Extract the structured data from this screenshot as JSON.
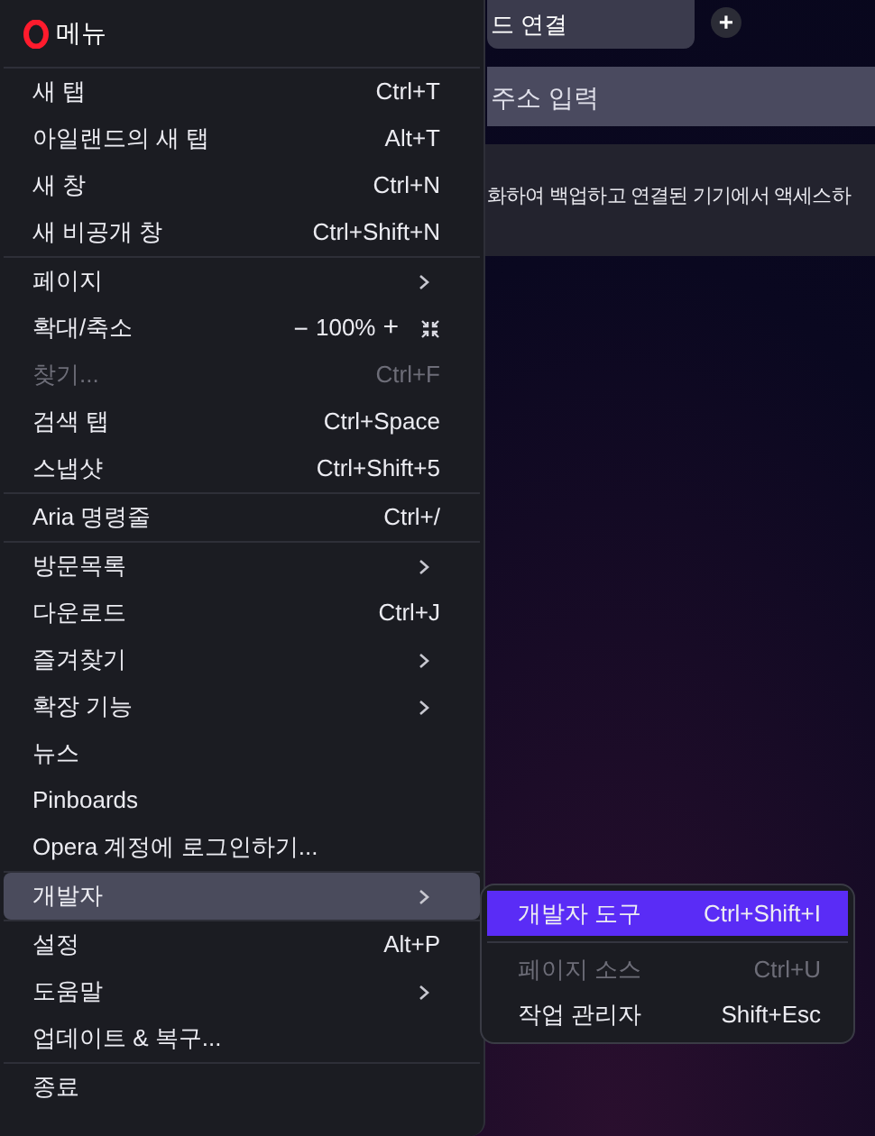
{
  "browser": {
    "tab": {
      "label": "드 연결"
    },
    "new_tab_button": "+",
    "address_bar": {
      "placeholder": "주소 입력"
    },
    "banner": {
      "text": "화하여 백업하고 연결된 기기에서 액세스하"
    }
  },
  "menu": {
    "title": "메뉴",
    "groups": [
      [
        {
          "kind": "item",
          "label": "새 탭",
          "shortcut": "Ctrl+T",
          "submenu": false,
          "disabled": false,
          "selected": false
        },
        {
          "kind": "item",
          "label": "아일랜드의 새 탭",
          "shortcut": "Alt+T",
          "submenu": false,
          "disabled": false,
          "selected": false
        },
        {
          "kind": "item",
          "label": "새 창",
          "shortcut": "Ctrl+N",
          "submenu": false,
          "disabled": false,
          "selected": false
        },
        {
          "kind": "item",
          "label": "새 비공개 창",
          "shortcut": "Ctrl+Shift+N",
          "submenu": false,
          "disabled": false,
          "selected": false
        }
      ],
      [
        {
          "kind": "item",
          "label": "페이지",
          "submenu": true,
          "disabled": false,
          "selected": false
        },
        {
          "kind": "zoom",
          "label": "확대/축소",
          "zoom_out": "−",
          "zoom_value": "100%",
          "zoom_in": "+",
          "disabled": false,
          "selected": false
        },
        {
          "kind": "item",
          "label": "찾기...",
          "shortcut": "Ctrl+F",
          "submenu": false,
          "disabled": true,
          "selected": false
        },
        {
          "kind": "item",
          "label": "검색 탭",
          "shortcut": "Ctrl+Space",
          "submenu": false,
          "disabled": false,
          "selected": false
        },
        {
          "kind": "item",
          "label": "스냅샷",
          "shortcut": "Ctrl+Shift+5",
          "submenu": false,
          "disabled": false,
          "selected": false
        }
      ],
      [
        {
          "kind": "item",
          "label": "Aria 명령줄",
          "shortcut": "Ctrl+/",
          "submenu": false,
          "disabled": false,
          "selected": false
        }
      ],
      [
        {
          "kind": "item",
          "label": "방문목록",
          "submenu": true,
          "disabled": false,
          "selected": false
        },
        {
          "kind": "item",
          "label": "다운로드",
          "shortcut": "Ctrl+J",
          "submenu": false,
          "disabled": false,
          "selected": false
        },
        {
          "kind": "item",
          "label": "즐겨찾기",
          "submenu": true,
          "disabled": false,
          "selected": false
        },
        {
          "kind": "item",
          "label": "확장 기능",
          "submenu": true,
          "disabled": false,
          "selected": false
        },
        {
          "kind": "item",
          "label": "뉴스",
          "submenu": false,
          "disabled": false,
          "selected": false
        },
        {
          "kind": "item",
          "label": "Pinboards",
          "submenu": false,
          "disabled": false,
          "selected": false
        },
        {
          "kind": "item",
          "label": "Opera 계정에 로그인하기...",
          "submenu": false,
          "disabled": false,
          "selected": false
        }
      ],
      [
        {
          "kind": "item",
          "label": "개발자",
          "submenu": true,
          "disabled": false,
          "selected": true
        }
      ],
      [
        {
          "kind": "item",
          "label": "설정",
          "shortcut": "Alt+P",
          "submenu": false,
          "disabled": false,
          "selected": false
        },
        {
          "kind": "item",
          "label": "도움말",
          "submenu": true,
          "disabled": false,
          "selected": false
        },
        {
          "kind": "item",
          "label": "업데이트 & 복구...",
          "submenu": false,
          "disabled": false,
          "selected": false
        }
      ],
      [
        {
          "kind": "item",
          "label": "종료",
          "submenu": false,
          "disabled": false,
          "selected": false
        }
      ]
    ]
  },
  "submenu": {
    "groups": [
      [
        {
          "label": "개발자 도구",
          "shortcut": "Ctrl+Shift+I",
          "disabled": false,
          "selected": true
        }
      ],
      [
        {
          "label": "페이지 소스",
          "shortcut": "Ctrl+U",
          "disabled": true,
          "selected": false
        },
        {
          "label": "작업 관리자",
          "shortcut": "Shift+Esc",
          "disabled": false,
          "selected": false
        }
      ]
    ]
  }
}
